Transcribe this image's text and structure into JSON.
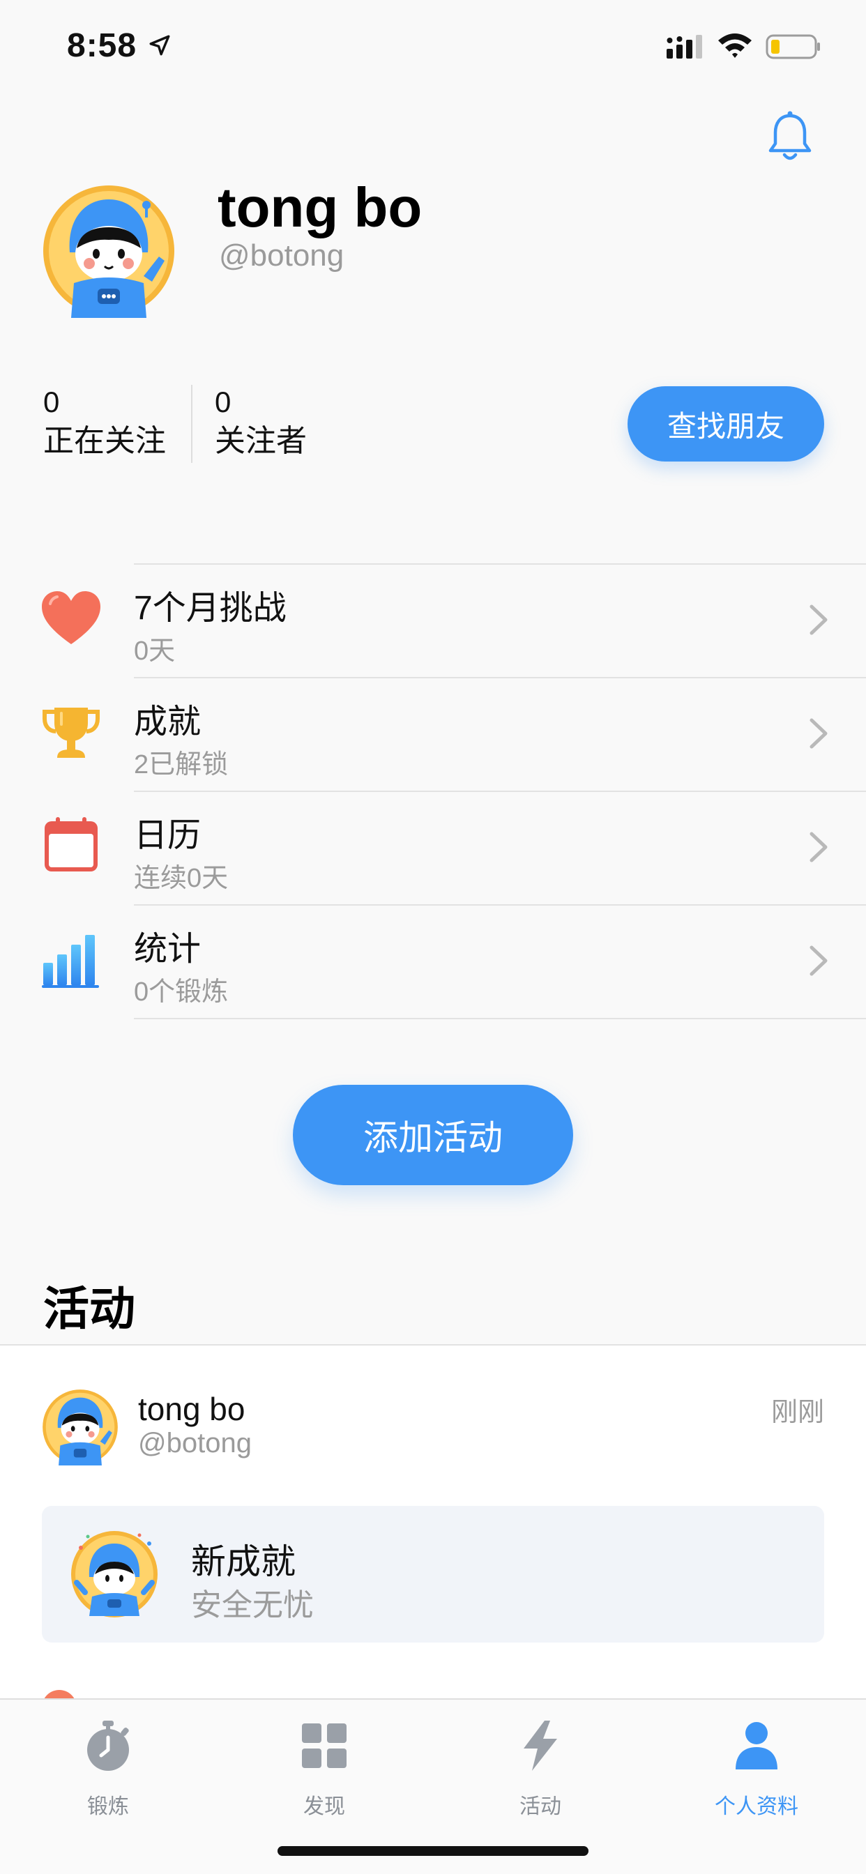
{
  "status_bar": {
    "time": "8:58"
  },
  "profile": {
    "name": "tong bo",
    "handle": "@botong",
    "following_count": "0",
    "following_label": "正在关注",
    "followers_count": "0",
    "followers_label": "关注者",
    "find_friends_label": "查找朋友"
  },
  "menu": {
    "items": [
      {
        "title": "7个月挑战",
        "subtitle": "0天",
        "icon": "heart-icon"
      },
      {
        "title": "成就",
        "subtitle": "2已解锁",
        "icon": "trophy-icon"
      },
      {
        "title": "日历",
        "subtitle": "连续0天",
        "icon": "calendar-icon"
      },
      {
        "title": "统计",
        "subtitle": "0个锻炼",
        "icon": "bar-chart-icon"
      }
    ]
  },
  "add_activity_label": "添加活动",
  "activity_section_title": "活动",
  "feed": {
    "name": "tong bo",
    "handle": "@botong",
    "time": "刚刚",
    "card_title": "新成就",
    "card_subtitle": "安全无忧"
  },
  "tabs": [
    {
      "label": "锻炼",
      "icon": "stopwatch-icon"
    },
    {
      "label": "发现",
      "icon": "grid-icon"
    },
    {
      "label": "活动",
      "icon": "lightning-icon"
    },
    {
      "label": "个人资料",
      "icon": "person-icon",
      "active": true
    }
  ],
  "colors": {
    "accent": "#3d95f5",
    "heart": "#f4705a",
    "trophy": "#f5b531",
    "calendar": "#e85a50"
  }
}
